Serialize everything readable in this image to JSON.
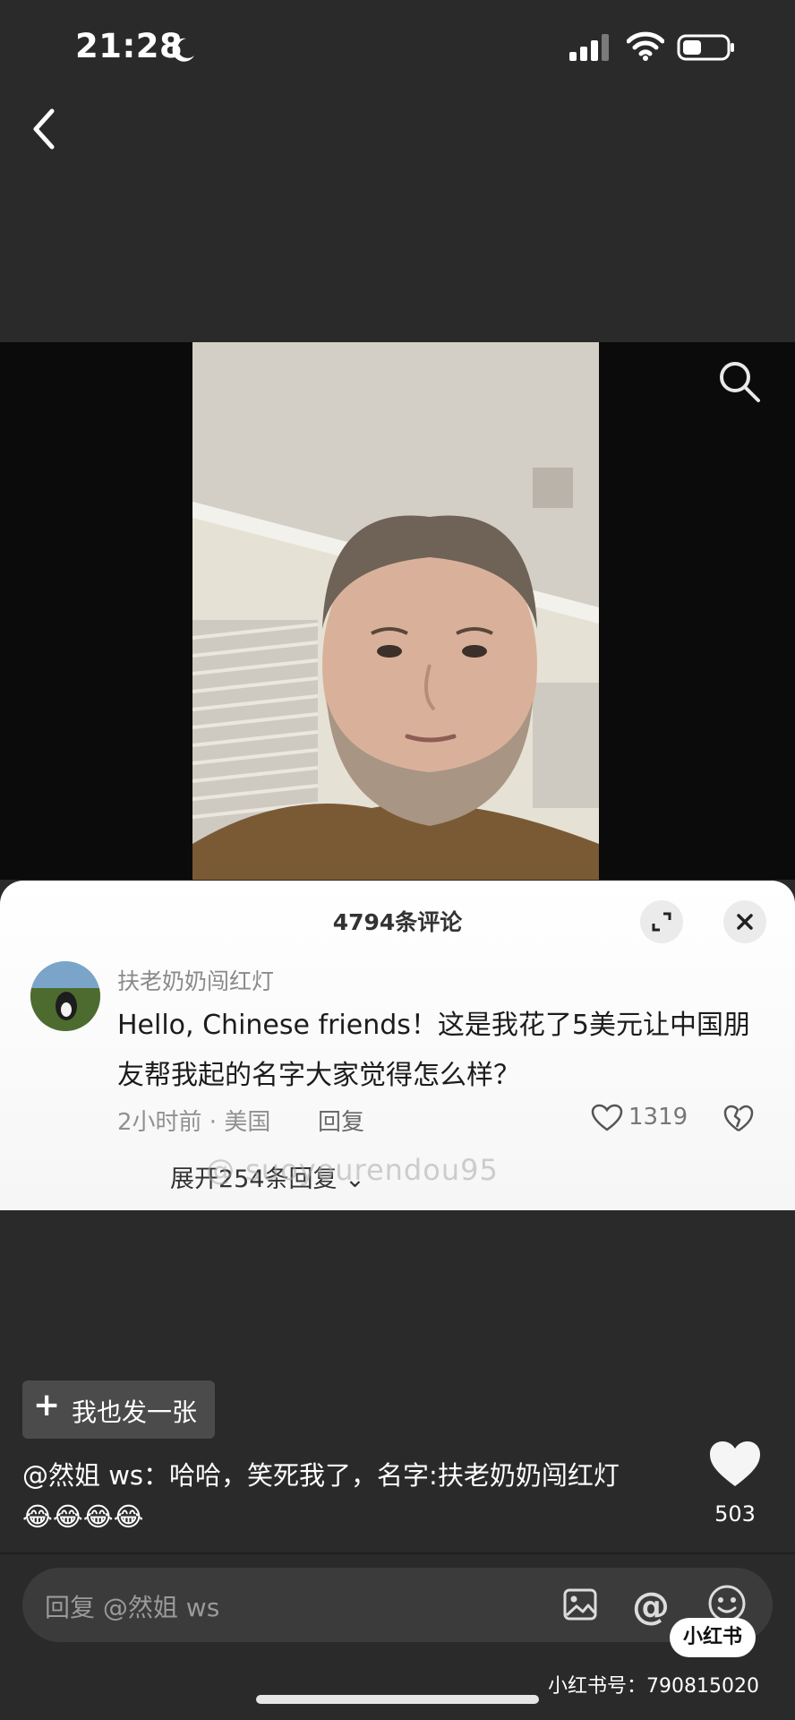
{
  "status_bar": {
    "time": "21:28",
    "icons": [
      "moon-icon",
      "signal-icon",
      "wifi-icon",
      "battery-icon"
    ]
  },
  "nav": {
    "back_icon": "chevron-left-icon",
    "search_icon": "search-icon"
  },
  "comments_panel": {
    "title": "4794条评论",
    "expand_icon": "expand-icon",
    "close_icon": "close-icon",
    "comment": {
      "username": "扶老奶奶闯红灯",
      "text": "Hello, Chinese friends！这是我花了5美元让中国朋友帮我起的名字大家觉得怎么样？",
      "meta": "2小时前 · 美国",
      "reply_label": "回复",
      "like_count": "1319",
      "expand_replies": "展开254条回复"
    },
    "watermark": "@ suoyourendou95"
  },
  "post": {
    "button_label": "我也发一张",
    "caption": "@然姐 ws：哈哈，笑死我了，名字:扶老奶奶闯红灯",
    "caption_emojis": "😂😂😂😂",
    "like_count": "503"
  },
  "reply_bar": {
    "placeholder": "回复 @然姐 ws",
    "at_symbol": "@"
  },
  "brand": {
    "logo_text": "小红书",
    "account_line": "小红书号：790815020"
  },
  "colors": {
    "background": "#2a2a2a",
    "card": "#ffffff",
    "reply_box": "#3b3b3b"
  }
}
